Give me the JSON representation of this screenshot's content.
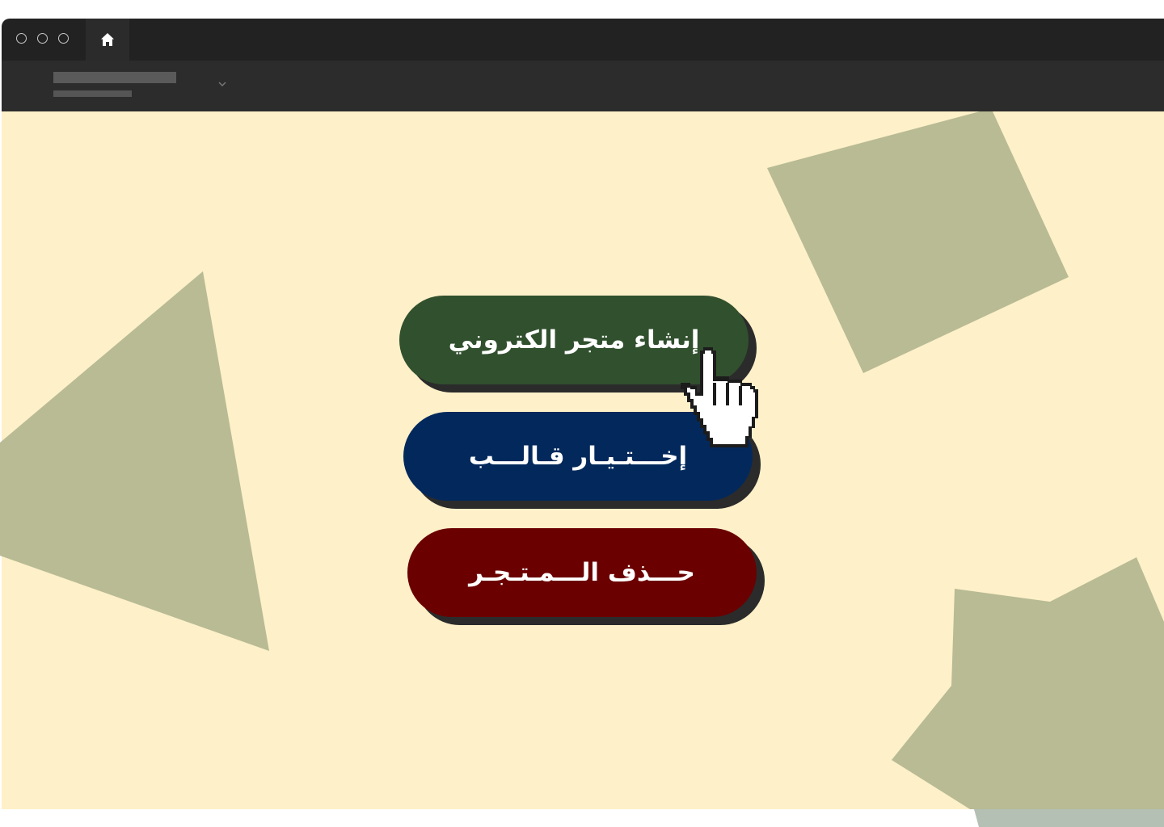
{
  "browser": {
    "tabs": [
      {
        "icon": "home-icon",
        "active": true
      }
    ],
    "window_controls": [
      "close",
      "minimize",
      "maximize"
    ]
  },
  "main": {
    "buttons": [
      {
        "label": "إنشاء متجر الكتروني",
        "color": "#31502e"
      },
      {
        "label": "إخـــتـيـار قـالـــب",
        "color": "#03295c"
      },
      {
        "label": "حـــذف الـــمـتـجـر",
        "color": "#6b0000"
      }
    ],
    "background_color": "#fef0c8",
    "shape_color": "#b8bb94"
  }
}
